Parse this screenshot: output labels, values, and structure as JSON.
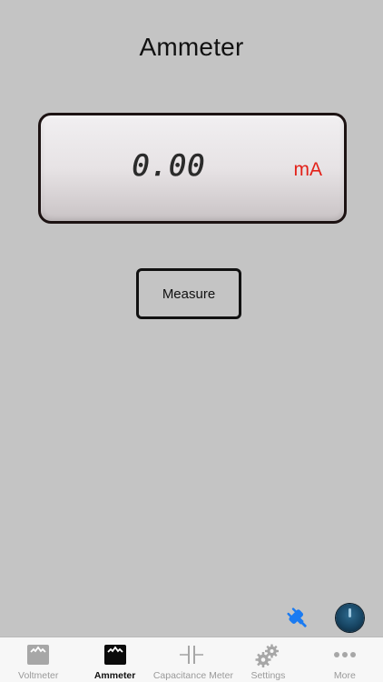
{
  "screen": {
    "title": "Ammeter"
  },
  "display": {
    "reading": "0.00",
    "unit": "mA",
    "unit_color": "#e32119"
  },
  "measure_button": {
    "label": "Measure"
  },
  "status_icons": {
    "connection": "plug-icon",
    "knob": "knob-icon",
    "connection_color": "#1a7bf2"
  },
  "tabbar": {
    "active_index": 1,
    "tabs": [
      {
        "label": "Voltmeter",
        "icon": "meter-icon"
      },
      {
        "label": "Ammeter",
        "icon": "meter-icon"
      },
      {
        "label": "Capacitance Meter",
        "icon": "capacitor-icon"
      },
      {
        "label": "Settings",
        "icon": "gears-icon"
      },
      {
        "label": "More",
        "icon": "ellipsis-icon"
      }
    ]
  }
}
